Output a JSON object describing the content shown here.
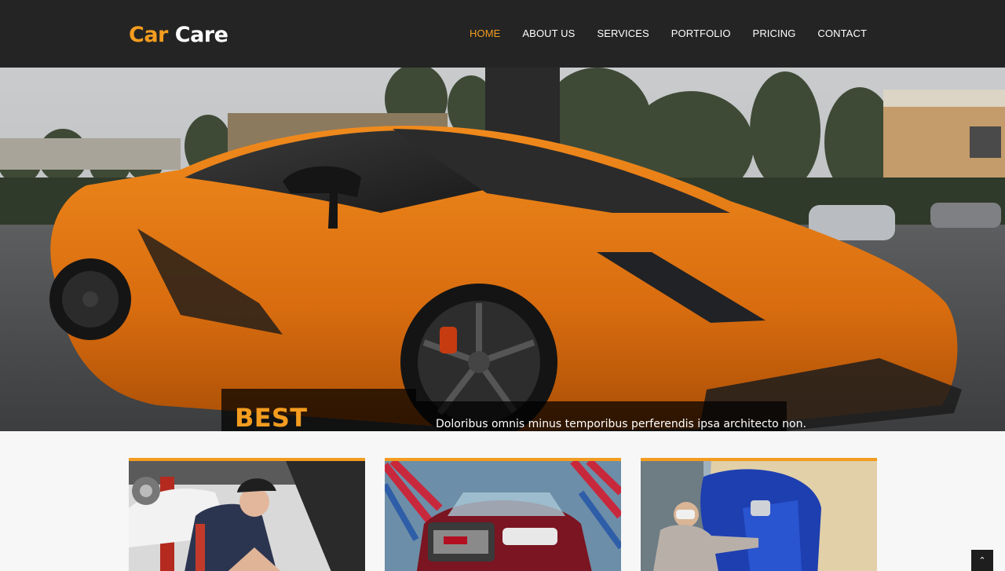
{
  "brand": {
    "part1": "Car",
    "part2": "Care"
  },
  "nav": [
    {
      "label": "HOME",
      "active": true
    },
    {
      "label": "ABOUT US",
      "active": false
    },
    {
      "label": "SERVICES",
      "active": false
    },
    {
      "label": "PORTFOLIO",
      "active": false
    },
    {
      "label": "PRICING",
      "active": false
    },
    {
      "label": "CONTACT",
      "active": false
    }
  ],
  "hero": {
    "title": "BEST SERVICE",
    "text": "Doloribus omnis minus temporibus perferendis ipsa architecto non."
  },
  "cards": [
    {
      "icon": "mechanic-photo"
    },
    {
      "icon": "car-wash-photo"
    },
    {
      "icon": "car-painting-photo"
    }
  ],
  "back_to_top": {
    "glyph": "⌃"
  },
  "colors": {
    "accent": "#f39c1f",
    "header_bg": "#242424",
    "page_bg": "#f7f7f7"
  }
}
